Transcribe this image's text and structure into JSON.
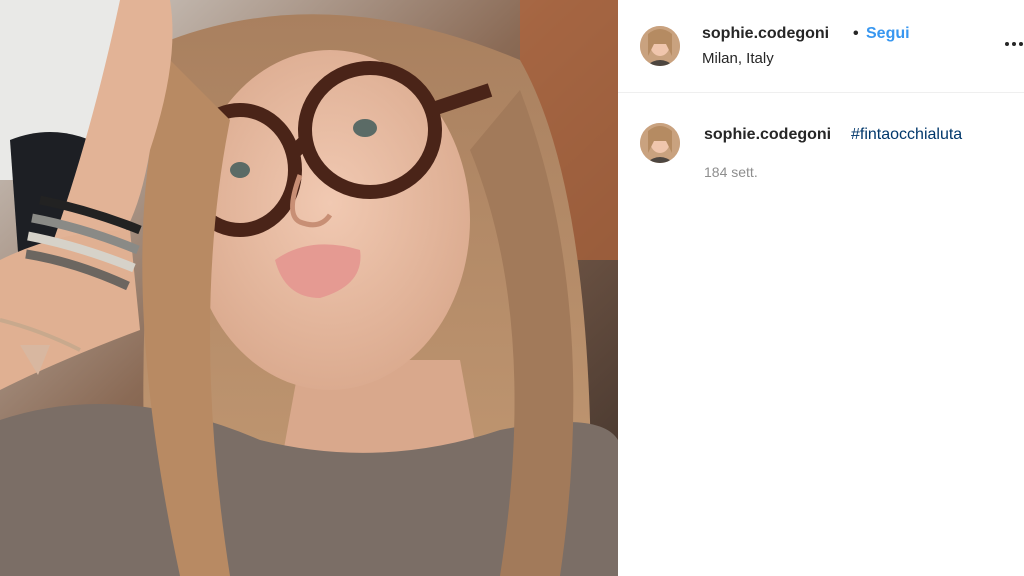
{
  "post": {
    "username": "sophie.codegoni",
    "separator": "•",
    "follow_label": "Segui",
    "location": "Milan, Italy",
    "more_icon": "more-horizontal-icon"
  },
  "caption": {
    "username": "sophie.codegoni",
    "hashtag": "#fintaocchialuta",
    "timestamp": "184 sett."
  },
  "colors": {
    "follow": "#3897f0",
    "hashtag": "#00376b",
    "timestamp": "#8e8e8e",
    "divider": "#efefef"
  }
}
